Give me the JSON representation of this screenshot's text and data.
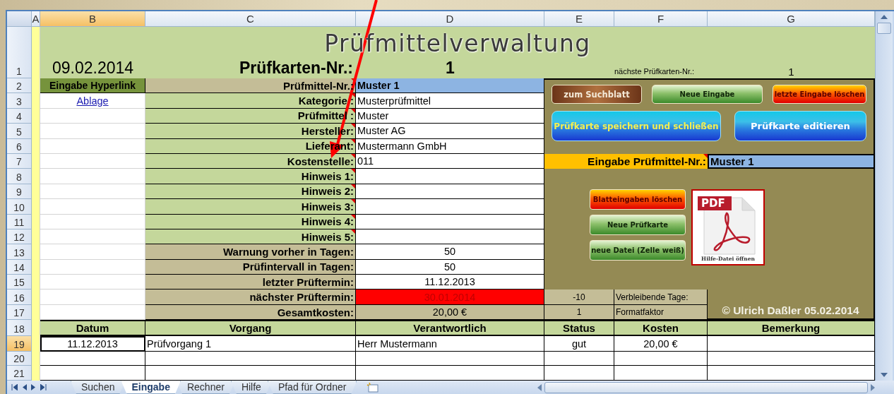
{
  "column_headers": [
    {
      "label": "A",
      "selected": false
    },
    {
      "label": "B",
      "selected": true
    },
    {
      "label": "C",
      "selected": false
    },
    {
      "label": "D",
      "selected": false
    },
    {
      "label": "E",
      "selected": false
    },
    {
      "label": "F",
      "selected": false
    },
    {
      "label": "G",
      "selected": false
    }
  ],
  "row_numbers": [
    {
      "label": "1",
      "selected": false
    },
    {
      "label": "2",
      "selected": false
    },
    {
      "label": "3",
      "selected": false
    },
    {
      "label": "4",
      "selected": false
    },
    {
      "label": "5",
      "selected": false
    },
    {
      "label": "6",
      "selected": false
    },
    {
      "label": "7",
      "selected": false
    },
    {
      "label": "8",
      "selected": false
    },
    {
      "label": "9",
      "selected": false
    },
    {
      "label": "10",
      "selected": false
    },
    {
      "label": "11",
      "selected": false
    },
    {
      "label": "12",
      "selected": false
    },
    {
      "label": "13",
      "selected": false
    },
    {
      "label": "14",
      "selected": false
    },
    {
      "label": "15",
      "selected": false
    },
    {
      "label": "16",
      "selected": false
    },
    {
      "label": "17",
      "selected": false
    },
    {
      "label": "18",
      "selected": false
    },
    {
      "label": "19",
      "selected": true
    },
    {
      "label": "20",
      "selected": false
    },
    {
      "label": "21",
      "selected": false
    }
  ],
  "title": "Prüfmittelverwaltung",
  "date": "09.02.2014",
  "card_number": {
    "label": "Prüfkarten-Nr.:",
    "value": "1"
  },
  "next_card_number": {
    "label": "nächste Prüfkarten-Nr.:",
    "value": "1"
  },
  "hyperlink": {
    "heading": "Eingabe Hyperlink",
    "link": "Ablage"
  },
  "fields": [
    {
      "label": "Prüfmittel-Nr.:",
      "value": "Muster 1",
      "kind": "id",
      "comment": true
    },
    {
      "label": "Kategorie :",
      "value": "Musterprüfmittel",
      "kind": "text",
      "comment": true
    },
    {
      "label": "Prüfmittel :",
      "value": "Muster",
      "kind": "text",
      "comment": true
    },
    {
      "label": "Hersteller:",
      "value": "Muster AG",
      "kind": "text",
      "comment": true
    },
    {
      "label": "Lieferant:",
      "value": "Mustermann GmbH",
      "kind": "text",
      "comment": true
    },
    {
      "label": "Kostenstelle:",
      "value": "011",
      "kind": "text",
      "comment": true
    },
    {
      "label": "Hinweis 1:",
      "kind": "text",
      "comment": true
    },
    {
      "label": "Hinweis 2:",
      "kind": "text",
      "comment": true
    },
    {
      "label": "Hinweis 3:",
      "kind": "text",
      "comment": true
    },
    {
      "label": "Hinweis 4:",
      "kind": "text",
      "comment": true
    },
    {
      "label": "Hinweis 5:",
      "kind": "text",
      "comment": true
    },
    {
      "label": "Warnung vorher in Tagen:",
      "value": "50",
      "kind": "setting",
      "comment": false
    },
    {
      "label": "Prüfintervall in Tagen:",
      "value": "50",
      "kind": "setting",
      "comment": false
    },
    {
      "label": "letzter Prüftermin:",
      "value": "11.12.2013",
      "kind": "setting",
      "comment": false
    },
    {
      "label": "nächster Prüftermin:",
      "value": "30.01.2014",
      "kind": "overdue",
      "comment": false
    },
    {
      "label": "Gesamtkosten:",
      "value": "20,00 €",
      "kind": "total",
      "comment": false
    }
  ],
  "remaining": [
    {
      "value": "-10",
      "label": "Verbleibende Tage:"
    },
    {
      "value": "1",
      "label": "Formatfaktor"
    }
  ],
  "top_buttons": [
    {
      "label": "zum Suchblatt",
      "kind": "brown"
    },
    {
      "label": "Neue Eingabe",
      "kind": "green"
    },
    {
      "label": "letzte Eingabe löschen",
      "kind": "alert"
    }
  ],
  "main_buttons": [
    {
      "label": "Prüfkarte speichern und schließen",
      "kind": "bluegold"
    },
    {
      "label": "Prüfkarte editieren",
      "kind": "blue"
    }
  ],
  "lookup": {
    "label": "Eingabe Prüfmittel-Nr.:",
    "value": "Muster 1",
    "comment": true
  },
  "action_buttons": [
    {
      "label": "Blatteingaben löschen",
      "kind": "alert"
    },
    {
      "label": "Neue Prüfkarte",
      "kind": "green"
    },
    {
      "label": "neue Datei (Zelle weiß)",
      "kind": "green"
    }
  ],
  "help_file": {
    "badge": "PDF",
    "caption": "Hilfe-Datei öffnen"
  },
  "copyright": "© Ulrich Daßler 05.02.2014",
  "log_table": {
    "columns": [
      "Datum",
      "Vorgang",
      "Verantwortlich",
      "Status",
      "Kosten",
      "Bemerkung"
    ],
    "rows": [
      {
        "date": "11.12.2013",
        "process": "Prüfvorgang 1",
        "responsible": "Herr Mustermann",
        "status": "gut",
        "cost": "20,00 €"
      }
    ]
  },
  "sheet_tabs": [
    {
      "label": "Suchen",
      "selected": false
    },
    {
      "label": "Eingabe",
      "selected": true
    },
    {
      "label": "Rechner",
      "selected": false
    },
    {
      "label": "Hilfe",
      "selected": false
    },
    {
      "label": "Pfad für Ordner",
      "selected": false
    }
  ]
}
